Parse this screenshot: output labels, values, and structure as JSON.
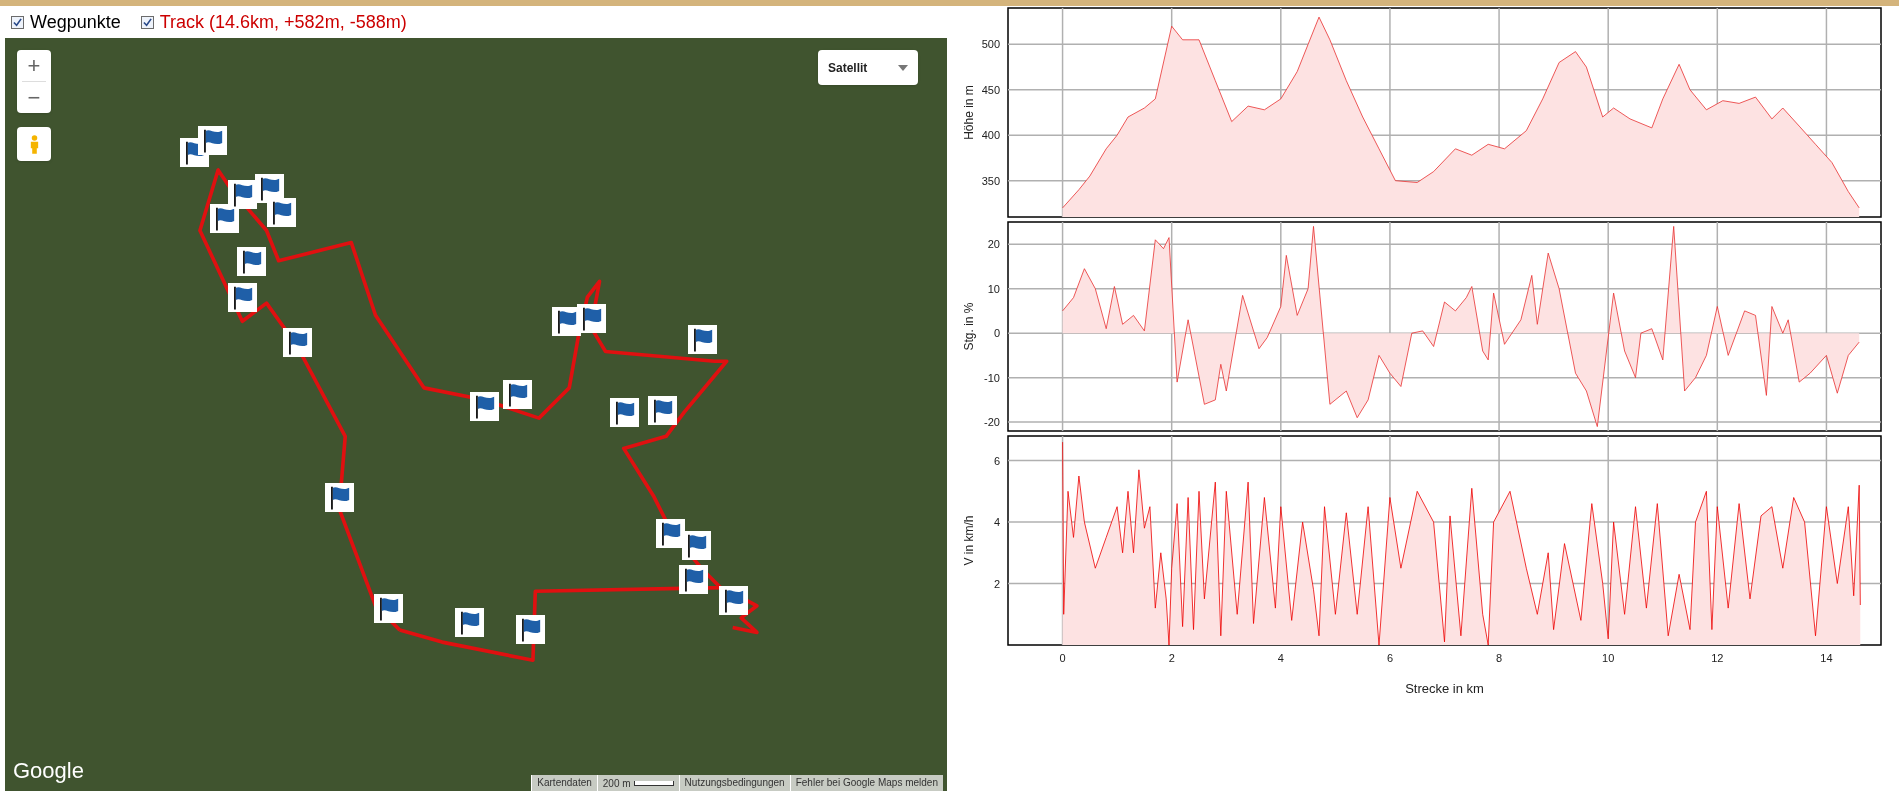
{
  "toggles": [
    {
      "label": "Wegpunkte",
      "checked": true,
      "color": "#000000"
    },
    {
      "label": "Track (14.6km, +582m, -588m)",
      "checked": true,
      "color": "#cc0000"
    }
  ],
  "map": {
    "zoom_in": "+",
    "zoom_out": "−",
    "map_type": "Satellit",
    "logo": "Google",
    "footer": [
      {
        "label": "Kartendaten",
        "kind": "text"
      },
      {
        "label": "200 m",
        "kind": "scale"
      },
      {
        "label": "Nutzungsbedingungen",
        "kind": "text"
      },
      {
        "label": "Fehler bei Google Maps melden",
        "kind": "text"
      }
    ]
  },
  "charts": [
    {
      "chart_data": {
        "type": "area",
        "grid": true,
        "ylabel": "Höhe in m",
        "xlim": [
          -1,
          15
        ],
        "ylim": [
          310,
          540
        ],
        "yticks": [
          350,
          400,
          450,
          500
        ],
        "x": [
          0,
          0.3,
          0.5,
          0.8,
          1,
          1.2,
          1.5,
          1.7,
          2,
          2.2,
          2.5,
          2.8,
          3.1,
          3.4,
          3.7,
          4,
          4.3,
          4.5,
          4.7,
          4.9,
          5.2,
          5.5,
          5.8,
          6.1,
          6.5,
          6.8,
          7.2,
          7.5,
          7.8,
          8.1,
          8.5,
          8.8,
          9.1,
          9.4,
          9.6,
          9.9,
          10.1,
          10.4,
          10.8,
          11,
          11.3,
          11.5,
          11.8,
          12.1,
          12.4,
          12.7,
          13,
          13.2,
          13.5,
          13.8,
          14.1,
          14.4,
          14.6
        ],
        "series": [
          {
            "color": "#e83030",
            "values": [
              320,
              340,
              355,
              385,
              400,
              420,
              430,
              440,
              520,
              505,
              505,
              460,
              415,
              432,
              428,
              440,
              470,
              500,
              530,
              505,
              460,
              420,
              385,
              350,
              348,
              360,
              385,
              378,
              390,
              385,
              405,
              440,
              480,
              492,
              475,
              420,
              430,
              418,
              408,
              440,
              478,
              450,
              428,
              438,
              435,
              442,
              418,
              430,
              410,
              390,
              370,
              338,
              320
            ]
          }
        ]
      }
    },
    {
      "chart_data": {
        "type": "area",
        "grid": true,
        "ylabel": "Stg. in %",
        "xlim": [
          -1,
          15
        ],
        "ylim": [
          -22,
          25
        ],
        "yticks": [
          -20,
          -10,
          0,
          10,
          20
        ],
        "x": [
          0,
          0.2,
          0.4,
          0.6,
          0.8,
          0.95,
          1.1,
          1.3,
          1.5,
          1.7,
          1.85,
          1.95,
          2.1,
          2.3,
          2.6,
          2.8,
          2.9,
          3,
          3.3,
          3.6,
          3.75,
          4,
          4.1,
          4.3,
          4.5,
          4.6,
          4.9,
          5.2,
          5.4,
          5.6,
          5.8,
          6,
          6.2,
          6.4,
          6.6,
          6.8,
          7,
          7.2,
          7.4,
          7.5,
          7.7,
          7.8,
          7.9,
          8.1,
          8.4,
          8.6,
          8.7,
          8.9,
          9.1,
          9.4,
          9.6,
          9.8,
          10.1,
          10.3,
          10.5,
          10.6,
          10.8,
          11,
          11.2,
          11.4,
          11.6,
          11.8,
          12,
          12.2,
          12.5,
          12.7,
          12.9,
          13,
          13.2,
          13.3,
          13.5,
          13.7,
          14,
          14.2,
          14.4,
          14.6
        ],
        "series": [
          {
            "color": "#e83030",
            "values": [
              5,
              8,
              14.5,
              10,
              1,
              10.5,
              2,
              4,
              0.5,
              21,
              19,
              21.5,
              -11,
              3,
              -16,
              -15,
              -7,
              -13,
              8.5,
              -3.5,
              -1,
              6,
              17.5,
              4,
              10,
              24,
              -16,
              -13,
              -19,
              -15,
              -5,
              -9,
              -12,
              0,
              0.5,
              -3,
              7,
              5,
              8,
              10.5,
              -4,
              -6,
              9,
              -2.5,
              3,
              13,
              2,
              18,
              10,
              -9,
              -13,
              -21,
              9,
              -4,
              -10,
              0,
              1,
              -6,
              24,
              -13,
              -10,
              -5,
              6,
              -5,
              5,
              4,
              -14,
              6,
              0,
              3,
              -11,
              -9,
              -5,
              -13.5,
              -5,
              -2
            ]
          }
        ]
      }
    },
    {
      "chart_data": {
        "type": "area",
        "grid": true,
        "ylabel": "V in km/h",
        "xlabel": "Strecke in km",
        "xlim": [
          -1,
          15
        ],
        "ylim": [
          0,
          6.8
        ],
        "yticks": [
          2,
          4,
          6
        ],
        "xticks": [
          0,
          2,
          4,
          6,
          8,
          10,
          12,
          14
        ],
        "x": [
          0,
          0.02,
          0.1,
          0.2,
          0.3,
          0.4,
          0.6,
          0.8,
          1,
          1.1,
          1.2,
          1.3,
          1.4,
          1.5,
          1.6,
          1.7,
          1.8,
          1.9,
          1.95,
          2,
          2.1,
          2.2,
          2.3,
          2.4,
          2.5,
          2.6,
          2.8,
          2.9,
          3,
          3.2,
          3.4,
          3.5,
          3.7,
          3.9,
          4,
          4.2,
          4.4,
          4.6,
          4.7,
          4.8,
          5,
          5.2,
          5.4,
          5.6,
          5.8,
          6,
          6.2,
          6.5,
          6.8,
          7,
          7.1,
          7.3,
          7.5,
          7.7,
          7.8,
          7.9,
          8.2,
          8.5,
          8.7,
          8.9,
          9,
          9.2,
          9.5,
          9.7,
          9.9,
          10,
          10.1,
          10.3,
          10.5,
          10.7,
          10.9,
          11.1,
          11.3,
          11.5,
          11.6,
          11.8,
          11.9,
          12,
          12.2,
          12.4,
          12.6,
          12.8,
          13,
          13.2,
          13.4,
          13.6,
          13.8,
          14,
          14.2,
          14.4,
          14.5,
          14.6,
          14.62
        ],
        "series": [
          {
            "color": "#ee0000",
            "values": [
              6.6,
              1,
              5,
              3.5,
              5.5,
              4,
              2.5,
              3.5,
              4.5,
              3,
              5,
              3,
              5.7,
              3.8,
              4.5,
              1.2,
              3,
              1.5,
              0,
              2.5,
              4.6,
              0.6,
              4.8,
              0.5,
              5,
              1.5,
              5.3,
              0.3,
              5,
              1,
              5.3,
              0.7,
              4.8,
              1.2,
              4.5,
              0.8,
              4,
              1.8,
              0.3,
              4.5,
              1,
              4.3,
              1,
              4.5,
              0,
              4.8,
              2.5,
              5,
              4,
              0.1,
              4.2,
              0.3,
              5.1,
              1,
              0,
              4,
              5,
              2.5,
              1,
              3,
              0.5,
              3.3,
              0.8,
              4.6,
              2,
              0.2,
              4,
              1,
              4.5,
              1.2,
              4.6,
              0.3,
              2.3,
              0.5,
              4,
              5,
              0.5,
              4.5,
              1.2,
              4.6,
              1.5,
              4.2,
              4.5,
              2.5,
              4.8,
              4,
              0.3,
              4.5,
              2,
              4.5,
              1.6,
              5.2,
              1.3
            ]
          }
        ]
      }
    }
  ]
}
